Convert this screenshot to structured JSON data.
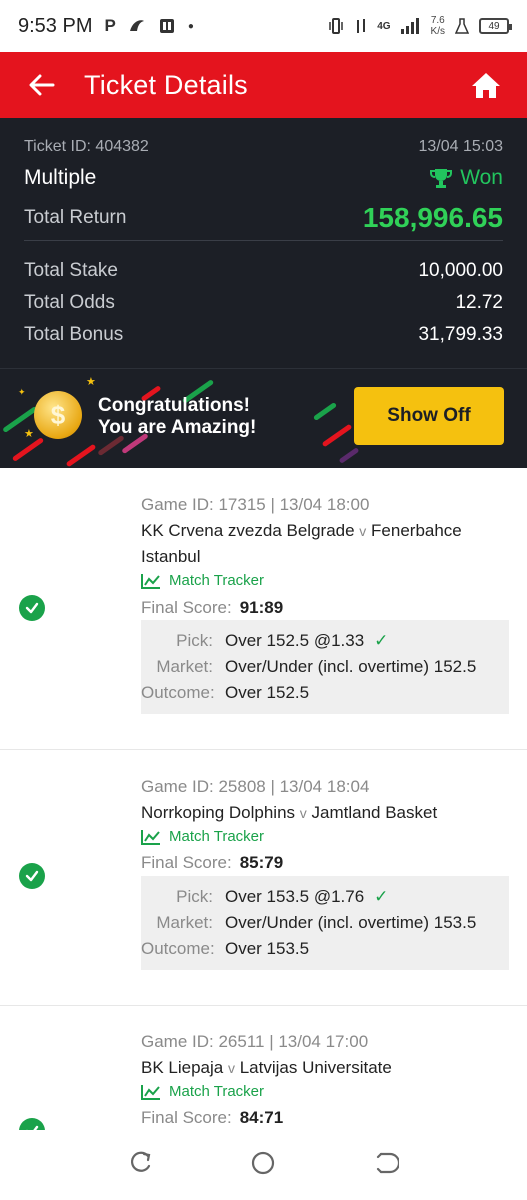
{
  "status_bar": {
    "time": "9:53 PM",
    "network": "4G",
    "speed_value": "7.6",
    "speed_unit": "K/s",
    "battery": "49"
  },
  "header": {
    "title": "Ticket Details"
  },
  "ticket": {
    "id_label": "Ticket ID: 404382",
    "datetime": "13/04 15:03",
    "type": "Multiple",
    "status": "Won",
    "total_return_label": "Total Return",
    "total_return": "158,996.65",
    "total_stake_label": "Total Stake",
    "total_stake": "10,000.00",
    "total_odds_label": "Total Odds",
    "total_odds": "12.72",
    "total_bonus_label": "Total Bonus",
    "total_bonus": "31,799.33"
  },
  "banner": {
    "line1": "Congratulations!",
    "line2": "You are Amazing!",
    "button": "Show Off"
  },
  "labels": {
    "match_tracker": "Match Tracker",
    "final_score": "Final Score:",
    "pick": "Pick:",
    "market": "Market:",
    "outcome": "Outcome:",
    "vs": "v"
  },
  "games": [
    {
      "game_line": "Game ID: 17315 | 13/04 18:00",
      "home": "KK Crvena zvezda Belgrade",
      "away": "Fenerbahce Istanbul",
      "final_score": "91:89",
      "pick": "Over 152.5 @1.33",
      "market": "Over/Under (incl. overtime) 152.5",
      "outcome": "Over 152.5"
    },
    {
      "game_line": "Game ID: 25808 | 13/04 18:04",
      "home": "Norrkoping Dolphins",
      "away": "Jamtland Basket",
      "final_score": "85:79",
      "pick": "Over 153.5 @1.76",
      "market": "Over/Under (incl. overtime) 153.5",
      "outcome": "Over 153.5"
    },
    {
      "game_line": "Game ID: 26511 | 13/04 17:00",
      "home": "BK Liepaja",
      "away": "Latvijas Universitate",
      "final_score": "84:71"
    }
  ],
  "colors": {
    "header_red": "#e4141e",
    "panel_dark": "#1c1f26",
    "won_green": "#22c55e",
    "accent_yellow": "#f5c10f"
  }
}
